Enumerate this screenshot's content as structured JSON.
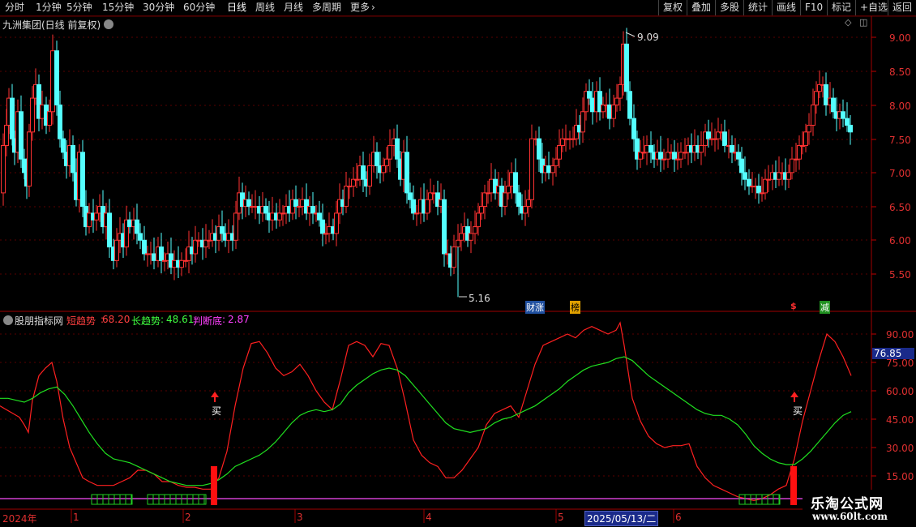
{
  "toolbar": {
    "periods": [
      "分时",
      "1分钟",
      "5分钟",
      "15分钟",
      "30分钟",
      "60分钟",
      "日线",
      "周线",
      "月线",
      "多周期",
      "更多"
    ],
    "active_period": "日线",
    "right_buttons": [
      "复权",
      "叠加",
      "多股",
      "统计",
      "画线",
      "F10",
      "标记",
      "+自选",
      "返回"
    ]
  },
  "main_chart": {
    "title": "九洲集团(日线 前复权)",
    "price_axis": [
      "9.00",
      "8.50",
      "8.00",
      "7.50",
      "7.00",
      "6.50",
      "6.00",
      "5.50"
    ],
    "high_label": "9.09",
    "low_label": "5.16",
    "event_tags": [
      "财涨",
      "榜",
      "$",
      "减"
    ]
  },
  "indicator_panel": {
    "name": "股朋指标网",
    "params": [
      {
        "label": "短趋势",
        "value": "68.20",
        "color": "#ff4040"
      },
      {
        "label": "长趋势",
        "value": "48.61",
        "color": "#40ff40"
      },
      {
        "label": "判断底",
        "value": "2.87",
        "color": "#ff40ff"
      }
    ],
    "axis": [
      "90.00",
      "75.00",
      "60.00",
      "45.00",
      "30.00",
      "15.00"
    ],
    "cursor_value": "76.85",
    "buy_label": "买"
  },
  "date_axis": {
    "labels": [
      "2024年",
      "1",
      "2",
      "3",
      "4",
      "5",
      "6"
    ],
    "cursor_date": "2025/05/13/二"
  },
  "watermark": {
    "title": "乐淘公式网",
    "url": "www.60lt.com"
  },
  "colors": {
    "up": "#ff3232",
    "down": "#54ffff",
    "short": "#ff2020",
    "long": "#20e020",
    "bottom": "#d040d0",
    "grid": "#5a0000"
  }
}
